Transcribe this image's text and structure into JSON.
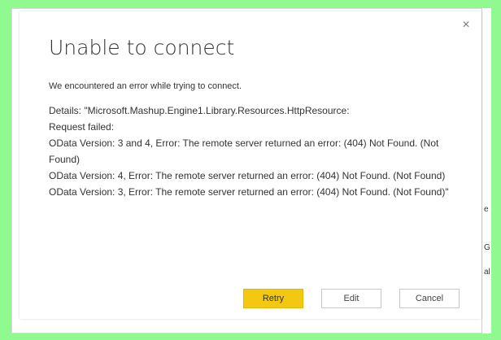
{
  "dialog": {
    "close_glyph": "×",
    "title": "Unable to connect",
    "lead": "We encountered an error while trying to connect.",
    "details": "Details: \"Microsoft.Mashup.Engine1.Library.Resources.HttpResource:",
    "request_failed": "Request failed:",
    "line1": "OData Version: 3 and 4, Error: The remote server returned an error: (404) Not Found. (Not Found)",
    "line2": "OData Version: 4, Error: The remote server returned an error: (404) Not Found. (Not Found)",
    "line3": "OData Version: 3, Error: The remote server returned an error: (404) Not Found. (Not Found)\"",
    "buttons": {
      "retry": "Retry",
      "edit": "Edit",
      "cancel": "Cancel"
    }
  },
  "right_strip": {
    "a": "e",
    "b": "G",
    "c": "al"
  },
  "colors": {
    "background": "#90f990",
    "retry_button": "#f2c811"
  }
}
